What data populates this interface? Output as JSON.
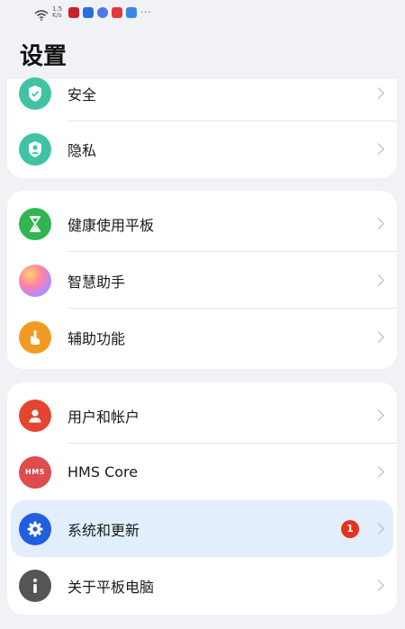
{
  "status_bar": {
    "network_speed": "1.5\nK/s",
    "overflow": "···"
  },
  "page": {
    "title": "设置"
  },
  "groups": [
    {
      "items": [
        {
          "label": "安全",
          "icon": "shield-icon",
          "color": "#3fc3a4"
        },
        {
          "label": "隐私",
          "icon": "privacy-icon",
          "color": "#3fc3a4"
        }
      ]
    },
    {
      "items": [
        {
          "label": "健康使用平板",
          "icon": "hourglass-icon",
          "color": "#2fb552"
        },
        {
          "label": "智慧助手",
          "icon": "assistant-orb-icon",
          "color": "#c780e8"
        },
        {
          "label": "辅助功能",
          "icon": "hand-icon",
          "color": "#f39a22"
        }
      ]
    },
    {
      "items": [
        {
          "label": "用户和帐户",
          "icon": "user-icon",
          "color": "#e5452e"
        },
        {
          "label": "HMS Core",
          "icon": "hms-icon",
          "icon_text": "HMS",
          "color": "#e04b4b"
        },
        {
          "label": "系统和更新",
          "icon": "gear-icon",
          "color": "#1f5fe0",
          "badge": "1",
          "selected": true
        },
        {
          "label": "关于平板电脑",
          "icon": "info-icon",
          "color": "#555555"
        }
      ]
    }
  ]
}
